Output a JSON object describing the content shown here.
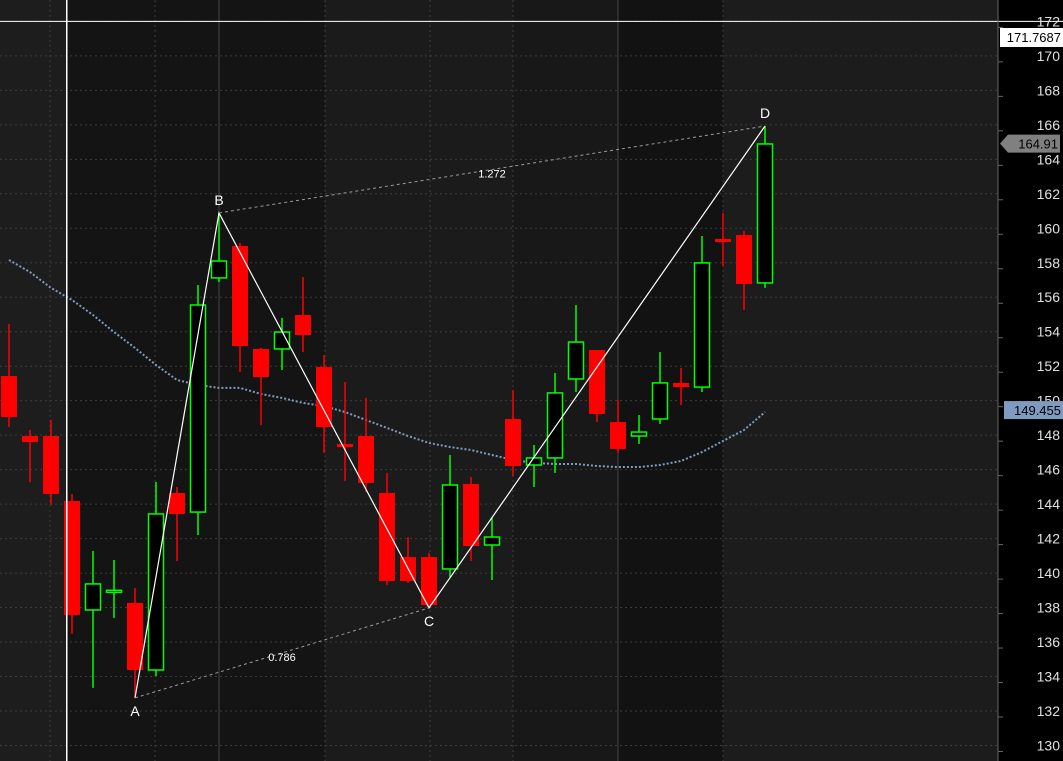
{
  "chart_data": {
    "type": "candlestick",
    "title": "",
    "xlabel": "",
    "ylabel": "",
    "ylim": [
      129,
      173
    ],
    "grid": true,
    "y_ticks": [
      130,
      132,
      134,
      136,
      138,
      140,
      142,
      144,
      146,
      148,
      150,
      152,
      154,
      156,
      158,
      160,
      162,
      164,
      166,
      168,
      170,
      172
    ],
    "colors": {
      "up": "#00ff00",
      "down": "#ff0000",
      "ma": "#7f9cc0",
      "pattern": "#ffffff",
      "ratio_line": "#9a9a9a"
    },
    "candles": [
      {
        "o": 151.43,
        "h": 154.45,
        "l": 148.47,
        "c": 149.05
      },
      {
        "o": 147.95,
        "h": 148.3,
        "l": 145.28,
        "c": 147.6
      },
      {
        "o": 147.95,
        "h": 148.88,
        "l": 143.95,
        "c": 144.59
      },
      {
        "o": 144.18,
        "h": 144.59,
        "l": 136.47,
        "c": 137.57
      },
      {
        "o": 137.86,
        "h": 141.28,
        "l": 133.34,
        "c": 139.37
      },
      {
        "o": 138.96,
        "h": 140.76,
        "l": 137.4,
        "c": 139.0
      },
      {
        "o": 138.27,
        "h": 139.14,
        "l": 132.76,
        "c": 134.38
      },
      {
        "o": 134.38,
        "h": 145.28,
        "l": 134.03,
        "c": 143.43
      },
      {
        "o": 144.65,
        "h": 144.99,
        "l": 140.7,
        "c": 143.43
      },
      {
        "o": 143.54,
        "h": 156.71,
        "l": 142.21,
        "c": 155.55
      },
      {
        "o": 157.12,
        "h": 160.89,
        "l": 156.88,
        "c": 158.1
      },
      {
        "o": 158.97,
        "h": 159.15,
        "l": 151.66,
        "c": 153.17
      },
      {
        "o": 153.0,
        "h": 153.06,
        "l": 148.59,
        "c": 151.37
      },
      {
        "o": 153.0,
        "h": 154.8,
        "l": 151.78,
        "c": 153.98
      },
      {
        "o": 154.97,
        "h": 157.17,
        "l": 152.82,
        "c": 153.81
      },
      {
        "o": 151.95,
        "h": 152.65,
        "l": 146.97,
        "c": 148.47
      },
      {
        "o": 147.49,
        "h": 151.08,
        "l": 145.34,
        "c": 147.31
      },
      {
        "o": 147.95,
        "h": 150.16,
        "l": 144.7,
        "c": 145.23
      },
      {
        "o": 144.65,
        "h": 145.81,
        "l": 139.31,
        "c": 139.54
      },
      {
        "o": 140.93,
        "h": 142.09,
        "l": 139.43,
        "c": 139.54
      },
      {
        "o": 140.93,
        "h": 141.17,
        "l": 137.98,
        "c": 138.15
      },
      {
        "o": 140.24,
        "h": 146.85,
        "l": 139.77,
        "c": 145.11
      },
      {
        "o": 145.17,
        "h": 145.57,
        "l": 140.7,
        "c": 141.57
      },
      {
        "o": 141.63,
        "h": 143.2,
        "l": 139.6,
        "c": 142.09
      },
      {
        "o": 148.94,
        "h": 150.62,
        "l": 145.63,
        "c": 146.21
      },
      {
        "o": 146.27,
        "h": 147.43,
        "l": 144.99,
        "c": 146.68
      },
      {
        "o": 146.68,
        "h": 151.61,
        "l": 145.81,
        "c": 150.45
      },
      {
        "o": 151.26,
        "h": 155.55,
        "l": 150.5,
        "c": 153.4
      },
      {
        "o": 152.94,
        "h": 152.94,
        "l": 148.76,
        "c": 149.23
      },
      {
        "o": 148.76,
        "h": 150.04,
        "l": 146.97,
        "c": 147.2
      },
      {
        "o": 147.95,
        "h": 149.17,
        "l": 147.49,
        "c": 148.18
      },
      {
        "o": 148.94,
        "h": 152.82,
        "l": 148.65,
        "c": 151.03
      },
      {
        "o": 151.03,
        "h": 151.9,
        "l": 149.75,
        "c": 150.79
      },
      {
        "o": 150.79,
        "h": 159.55,
        "l": 150.5,
        "c": 157.99
      },
      {
        "o": 159.38,
        "h": 160.89,
        "l": 157.81,
        "c": 159.2
      },
      {
        "o": 159.61,
        "h": 159.84,
        "l": 155.26,
        "c": 156.77
      },
      {
        "o": 156.83,
        "h": 165.93,
        "l": 156.54,
        "c": 164.89
      }
    ],
    "moving_average": [
      158.16,
      157.46,
      156.54,
      155.84,
      154.97,
      153.98,
      153.06,
      152.07,
      151.2,
      150.91,
      150.74,
      150.74,
      150.39,
      150.16,
      149.87,
      149.69,
      149.34,
      148.88,
      148.42,
      147.95,
      147.55,
      147.31,
      147.14,
      146.85,
      146.56,
      146.39,
      146.33,
      146.33,
      146.21,
      146.15,
      146.15,
      146.27,
      146.5,
      147.02,
      147.66,
      148.3,
      149.34
    ],
    "pattern_points": [
      {
        "label": "A",
        "index": 6,
        "price": 132.76,
        "position": "below"
      },
      {
        "label": "B",
        "index": 10,
        "price": 160.89,
        "position": "above"
      },
      {
        "label": "C",
        "index": 20,
        "price": 137.98,
        "position": "below"
      },
      {
        "label": "D",
        "index": 36,
        "price": 165.93,
        "position": "above"
      }
    ],
    "ratios": [
      {
        "label": "0.786",
        "from": "A",
        "to": "C"
      },
      {
        "label": "1.272",
        "from": "B",
        "to": "D"
      }
    ],
    "crosshair": {
      "price_label": "171.7687",
      "price": 172.0,
      "index": 2.75
    },
    "tags": [
      {
        "label": "164.91",
        "price": 164.91,
        "style": "last-price"
      },
      {
        "label": "149.455",
        "price": 149.455,
        "style": "ma-value"
      }
    ]
  }
}
